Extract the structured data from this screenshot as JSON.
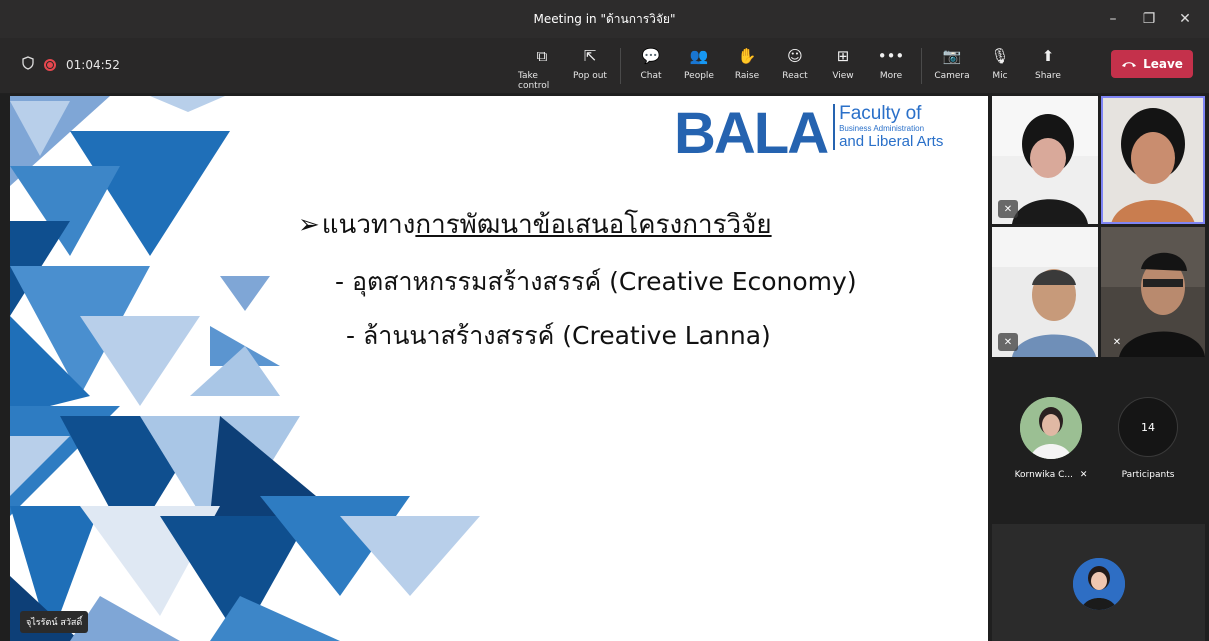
{
  "window": {
    "title": "Meeting in \"ด้านการวิจัย\"",
    "controls": [
      "–",
      "❐",
      "✕"
    ]
  },
  "status": {
    "timer": "01:04:52"
  },
  "toolbar": {
    "tools": [
      {
        "id": "take-control",
        "label": "Take control",
        "icon": "⧉"
      },
      {
        "id": "pop-out",
        "label": "Pop out",
        "icon": "⇱"
      },
      {
        "id": "chat",
        "label": "Chat",
        "icon": "💬"
      },
      {
        "id": "people",
        "label": "People",
        "icon": "👥"
      },
      {
        "id": "raise",
        "label": "Raise",
        "icon": "✋"
      },
      {
        "id": "react",
        "label": "React",
        "icon": "☺"
      },
      {
        "id": "view",
        "label": "View",
        "icon": "⊞"
      },
      {
        "id": "more",
        "label": "More",
        "icon": "•••"
      },
      {
        "id": "camera",
        "label": "Camera",
        "icon": "📷"
      },
      {
        "id": "mic",
        "label": "Mic",
        "icon": "🎙"
      },
      {
        "id": "share",
        "label": "Share",
        "icon": "⬆"
      }
    ],
    "leave_label": "Leave"
  },
  "slide": {
    "logo_big": "BALA",
    "logo_line1": "Faculty of",
    "logo_line2": "Business Administration",
    "logo_line3": "and Liberal Arts",
    "arrow": "➢",
    "heading_plain": "แนวทาง",
    "heading_underlined": "การพัฒนาข้อเสนอโครงการวิจัย",
    "bullet1": "- อุตสาหกรรมสร้างสรรค์ (Creative Economy)",
    "bullet2": "- ล้านนาสร้างสรรค์ (Creative Lanna)",
    "presenter_name": "จุไรรัตน์ สวัสดิ์"
  },
  "roster": {
    "participant_name": "Kornwika C...",
    "participants_count": "14",
    "participants_label": "Participants"
  },
  "colors": {
    "leave": "#c4314b",
    "accent": "#7f85f5",
    "slide_blue": "#2563b0"
  }
}
